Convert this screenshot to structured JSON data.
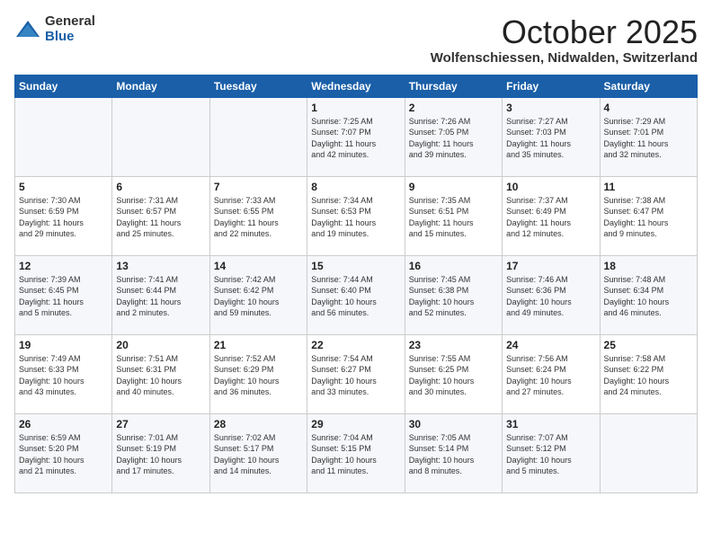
{
  "header": {
    "logo_general": "General",
    "logo_blue": "Blue",
    "month_title": "October 2025",
    "location": "Wolfenschiessen, Nidwalden, Switzerland"
  },
  "days_of_week": [
    "Sunday",
    "Monday",
    "Tuesday",
    "Wednesday",
    "Thursday",
    "Friday",
    "Saturday"
  ],
  "weeks": [
    [
      {
        "day": "",
        "content": ""
      },
      {
        "day": "",
        "content": ""
      },
      {
        "day": "",
        "content": ""
      },
      {
        "day": "1",
        "content": "Sunrise: 7:25 AM\nSunset: 7:07 PM\nDaylight: 11 hours\nand 42 minutes."
      },
      {
        "day": "2",
        "content": "Sunrise: 7:26 AM\nSunset: 7:05 PM\nDaylight: 11 hours\nand 39 minutes."
      },
      {
        "day": "3",
        "content": "Sunrise: 7:27 AM\nSunset: 7:03 PM\nDaylight: 11 hours\nand 35 minutes."
      },
      {
        "day": "4",
        "content": "Sunrise: 7:29 AM\nSunset: 7:01 PM\nDaylight: 11 hours\nand 32 minutes."
      }
    ],
    [
      {
        "day": "5",
        "content": "Sunrise: 7:30 AM\nSunset: 6:59 PM\nDaylight: 11 hours\nand 29 minutes."
      },
      {
        "day": "6",
        "content": "Sunrise: 7:31 AM\nSunset: 6:57 PM\nDaylight: 11 hours\nand 25 minutes."
      },
      {
        "day": "7",
        "content": "Sunrise: 7:33 AM\nSunset: 6:55 PM\nDaylight: 11 hours\nand 22 minutes."
      },
      {
        "day": "8",
        "content": "Sunrise: 7:34 AM\nSunset: 6:53 PM\nDaylight: 11 hours\nand 19 minutes."
      },
      {
        "day": "9",
        "content": "Sunrise: 7:35 AM\nSunset: 6:51 PM\nDaylight: 11 hours\nand 15 minutes."
      },
      {
        "day": "10",
        "content": "Sunrise: 7:37 AM\nSunset: 6:49 PM\nDaylight: 11 hours\nand 12 minutes."
      },
      {
        "day": "11",
        "content": "Sunrise: 7:38 AM\nSunset: 6:47 PM\nDaylight: 11 hours\nand 9 minutes."
      }
    ],
    [
      {
        "day": "12",
        "content": "Sunrise: 7:39 AM\nSunset: 6:45 PM\nDaylight: 11 hours\nand 5 minutes."
      },
      {
        "day": "13",
        "content": "Sunrise: 7:41 AM\nSunset: 6:44 PM\nDaylight: 11 hours\nand 2 minutes."
      },
      {
        "day": "14",
        "content": "Sunrise: 7:42 AM\nSunset: 6:42 PM\nDaylight: 10 hours\nand 59 minutes."
      },
      {
        "day": "15",
        "content": "Sunrise: 7:44 AM\nSunset: 6:40 PM\nDaylight: 10 hours\nand 56 minutes."
      },
      {
        "day": "16",
        "content": "Sunrise: 7:45 AM\nSunset: 6:38 PM\nDaylight: 10 hours\nand 52 minutes."
      },
      {
        "day": "17",
        "content": "Sunrise: 7:46 AM\nSunset: 6:36 PM\nDaylight: 10 hours\nand 49 minutes."
      },
      {
        "day": "18",
        "content": "Sunrise: 7:48 AM\nSunset: 6:34 PM\nDaylight: 10 hours\nand 46 minutes."
      }
    ],
    [
      {
        "day": "19",
        "content": "Sunrise: 7:49 AM\nSunset: 6:33 PM\nDaylight: 10 hours\nand 43 minutes."
      },
      {
        "day": "20",
        "content": "Sunrise: 7:51 AM\nSunset: 6:31 PM\nDaylight: 10 hours\nand 40 minutes."
      },
      {
        "day": "21",
        "content": "Sunrise: 7:52 AM\nSunset: 6:29 PM\nDaylight: 10 hours\nand 36 minutes."
      },
      {
        "day": "22",
        "content": "Sunrise: 7:54 AM\nSunset: 6:27 PM\nDaylight: 10 hours\nand 33 minutes."
      },
      {
        "day": "23",
        "content": "Sunrise: 7:55 AM\nSunset: 6:25 PM\nDaylight: 10 hours\nand 30 minutes."
      },
      {
        "day": "24",
        "content": "Sunrise: 7:56 AM\nSunset: 6:24 PM\nDaylight: 10 hours\nand 27 minutes."
      },
      {
        "day": "25",
        "content": "Sunrise: 7:58 AM\nSunset: 6:22 PM\nDaylight: 10 hours\nand 24 minutes."
      }
    ],
    [
      {
        "day": "26",
        "content": "Sunrise: 6:59 AM\nSunset: 5:20 PM\nDaylight: 10 hours\nand 21 minutes."
      },
      {
        "day": "27",
        "content": "Sunrise: 7:01 AM\nSunset: 5:19 PM\nDaylight: 10 hours\nand 17 minutes."
      },
      {
        "day": "28",
        "content": "Sunrise: 7:02 AM\nSunset: 5:17 PM\nDaylight: 10 hours\nand 14 minutes."
      },
      {
        "day": "29",
        "content": "Sunrise: 7:04 AM\nSunset: 5:15 PM\nDaylight: 10 hours\nand 11 minutes."
      },
      {
        "day": "30",
        "content": "Sunrise: 7:05 AM\nSunset: 5:14 PM\nDaylight: 10 hours\nand 8 minutes."
      },
      {
        "day": "31",
        "content": "Sunrise: 7:07 AM\nSunset: 5:12 PM\nDaylight: 10 hours\nand 5 minutes."
      },
      {
        "day": "",
        "content": ""
      }
    ]
  ]
}
